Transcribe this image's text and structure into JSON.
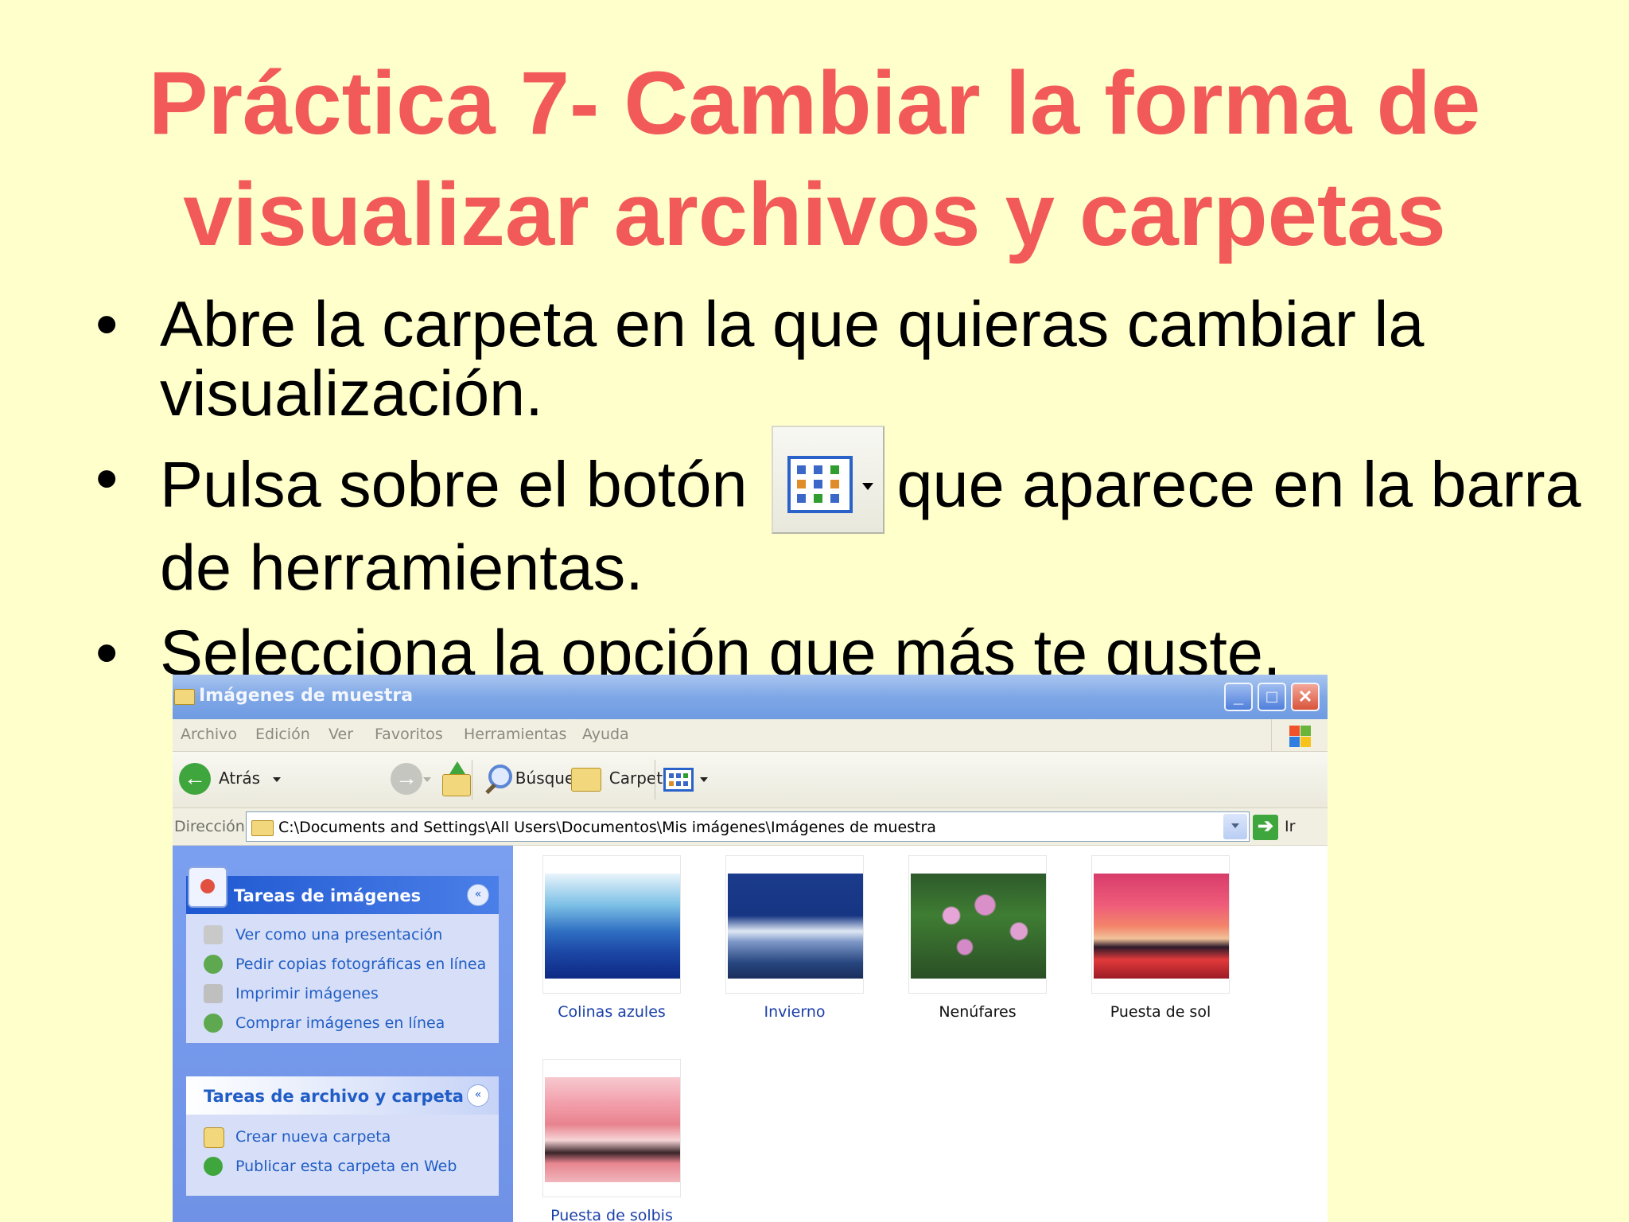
{
  "slide": {
    "title_line1": "Práctica 7- Cambiar la forma de",
    "title_line2": "visualizar archivos y carpetas",
    "bullet_glyph": "•",
    "bullets": [
      {
        "text": "Abre la carpeta en la que quieras cambiar la visualización."
      },
      {
        "text_before": "Pulsa sobre el botón",
        "text_after": "que aparece en la barra de herramientas."
      },
      {
        "text": "Selecciona la opción que más te guste."
      }
    ]
  },
  "window": {
    "title": "Imágenes de muestra",
    "controls": {
      "minimize": "_",
      "maximize": "□",
      "close": "✕"
    },
    "menu": [
      "Archivo",
      "Edición",
      "Ver",
      "Favoritos",
      "Herramientas",
      "Ayuda"
    ],
    "toolbar": {
      "back": "Atrás",
      "back_glyph": "←",
      "forward_glyph": "→",
      "search": "Búsqueda",
      "folders": "Carpetas"
    },
    "address": {
      "label": "Dirección",
      "path": "C:\\Documents and Settings\\All Users\\Documentos\\Mis imágenes\\Imágenes de muestra",
      "go": "Ir",
      "go_glyph": "➔"
    },
    "task_panels": [
      {
        "title": "Tareas de imágenes",
        "toggle": "«",
        "items": [
          "Ver como una presentación",
          "Pedir copias fotográficas en línea",
          "Imprimir imágenes",
          "Comprar imágenes en línea"
        ]
      },
      {
        "title": "Tareas de archivo y carpeta",
        "toggle": "«",
        "items": [
          "Crear nueva carpeta",
          "Publicar esta carpeta en Web"
        ]
      }
    ],
    "files": [
      {
        "name": "Colinas azules"
      },
      {
        "name": "Invierno"
      },
      {
        "name": "Nenúfares"
      },
      {
        "name": "Puesta de sol"
      },
      {
        "name": "Puesta de solbis"
      }
    ]
  },
  "colors": {
    "slide_background": "#ffffcc",
    "title": "#f25a5a",
    "xp_blue": "#2a62c9",
    "link_blue": "#215dc6"
  }
}
